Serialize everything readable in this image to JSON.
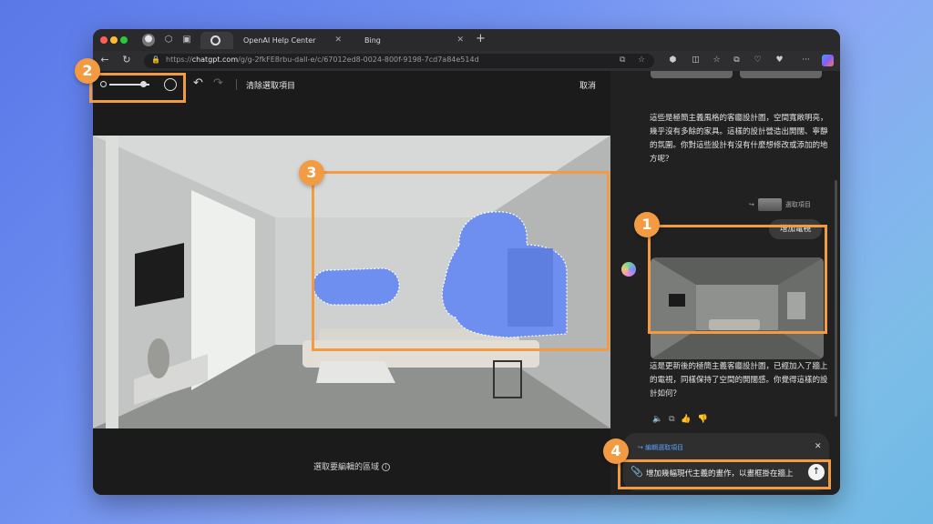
{
  "browser": {
    "tabs": [
      {
        "label": ""
      },
      {
        "label": "OpenAI Help Center"
      },
      {
        "label": "Bing"
      }
    ],
    "url_prefix": "https://",
    "url_host": "chatgpt.com",
    "url_path": "/g/g-2fkFE8rbu-dall-e/c/67012ed8-0024-800f-9198-7cd7a84e514d"
  },
  "editor": {
    "clear_label": "清除選取項目",
    "cancel_label": "取消",
    "hint": "選取要編輯的區域"
  },
  "chat": {
    "msg1": "這些是極簡主義風格的客廳設計圖，空間寬敞明亮，幾乎沒有多餘的家具。這樣的設計營造出開闊、寧靜的氛圍。你對這些設計有沒有什麼想修改或添加的地方呢？",
    "selection_label": "選取項目",
    "user_bubble": "增加電視",
    "msg2": "這是更新後的極簡主義客廳設計圖，已經加入了牆上的電視，同樣保持了空間的開闊感。你覺得這樣的設計如何？",
    "edit_label": "編輯選取項目",
    "prompt": "增加幾幅現代主義的畫作，以畫框掛在牆上"
  },
  "annotations": {
    "badge1": "1",
    "badge2": "2",
    "badge3": "3",
    "badge4": "4"
  },
  "colors": {
    "accent": "#f29b42",
    "selection": "#6f8ff0",
    "link": "#5aa2ff"
  }
}
